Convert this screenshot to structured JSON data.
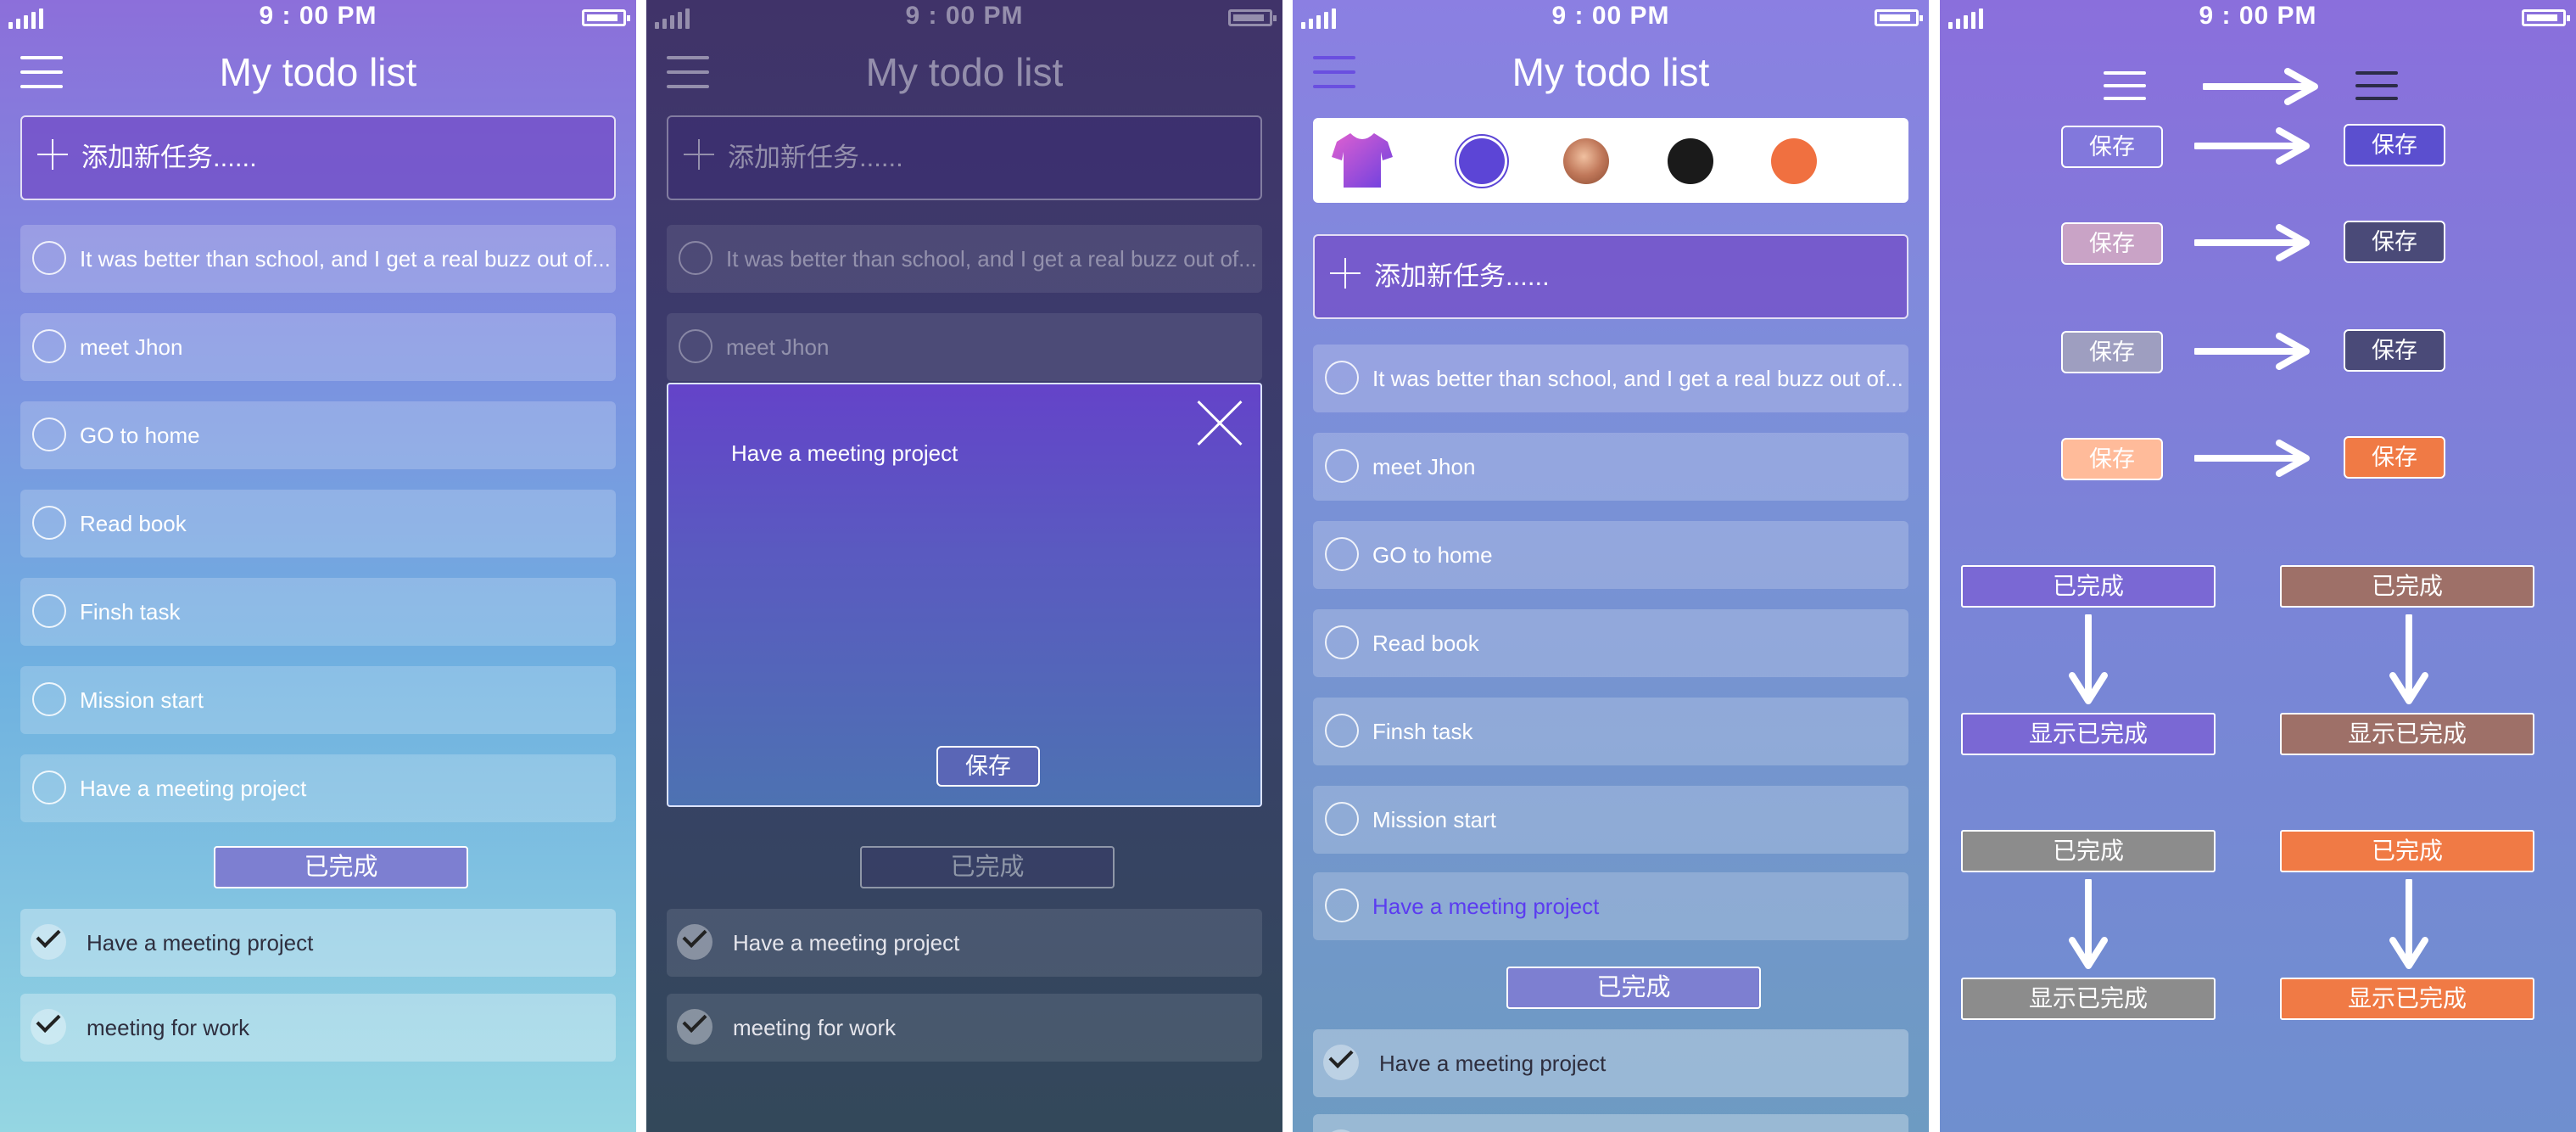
{
  "status": {
    "time": "9 : 00 PM"
  },
  "app": {
    "title": "My todo list",
    "add_placeholder": "添加新任务......"
  },
  "tasks": [
    "It was better than school, and I get a real buzz out of...",
    "meet Jhon",
    "GO to home",
    "Read book",
    "Finsh task",
    "Mission start",
    "Have a meeting project"
  ],
  "completed_label": "已完成",
  "completed_tasks": [
    "Have a meeting project",
    "meeting for work"
  ],
  "modal": {
    "text": "Have a meeting project",
    "save_label": "保存"
  },
  "palette": {
    "icons": [
      "shirt-icon"
    ],
    "colors": [
      "#5c45d6",
      "#c0785a",
      "#1a1a1a",
      "#f07040"
    ]
  },
  "guide": {
    "save_label": "保存",
    "completed_label": "已完成",
    "show_completed_label": "显示已完成",
    "save_pairs": [
      {
        "from": "rgba(130,120,220,1)",
        "to": "#5b4fcf"
      },
      {
        "from": "#c9a3c6",
        "to": "#4a4a78"
      },
      {
        "from": "#9e9ec0",
        "to": "#4a4a78"
      },
      {
        "from": "#ffbb9a",
        "to": "#f07a45"
      }
    ],
    "tag_colors": [
      "#7a68d4",
      "#9e7068",
      "#8c8c8c",
      "#f07a45"
    ]
  },
  "colors": {
    "accent": "#5b3cf0",
    "purple": "#6443c9"
  }
}
